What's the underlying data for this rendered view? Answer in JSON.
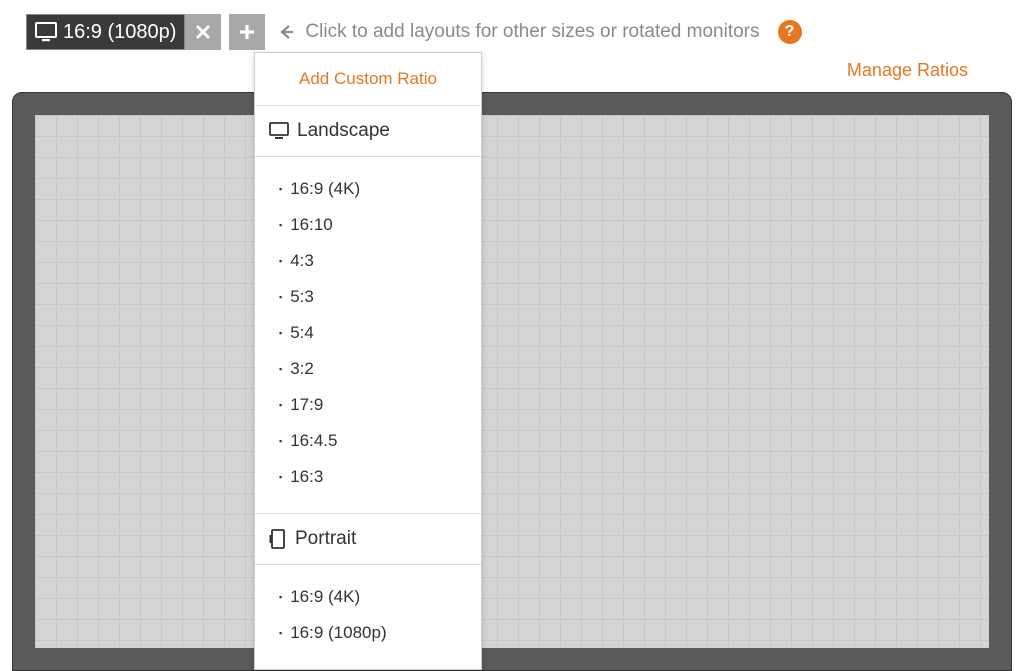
{
  "toolbar": {
    "current_ratio": "16:9 (1080p)",
    "hint_text": "Click to add layouts for other sizes or rotated monitors",
    "help_symbol": "?"
  },
  "dropdown": {
    "custom_label": "Add Custom Ratio",
    "landscape_label": "Landscape",
    "landscape_items": [
      "16:9 (4K)",
      "16:10",
      "4:3",
      "5:3",
      "5:4",
      "3:2",
      "17:9",
      "16:4.5",
      "16:3"
    ],
    "portrait_label": "Portrait",
    "portrait_items": [
      "16:9 (4K)",
      "16:9 (1080p)"
    ]
  },
  "links": {
    "manage_ratios": "Manage Ratios"
  }
}
